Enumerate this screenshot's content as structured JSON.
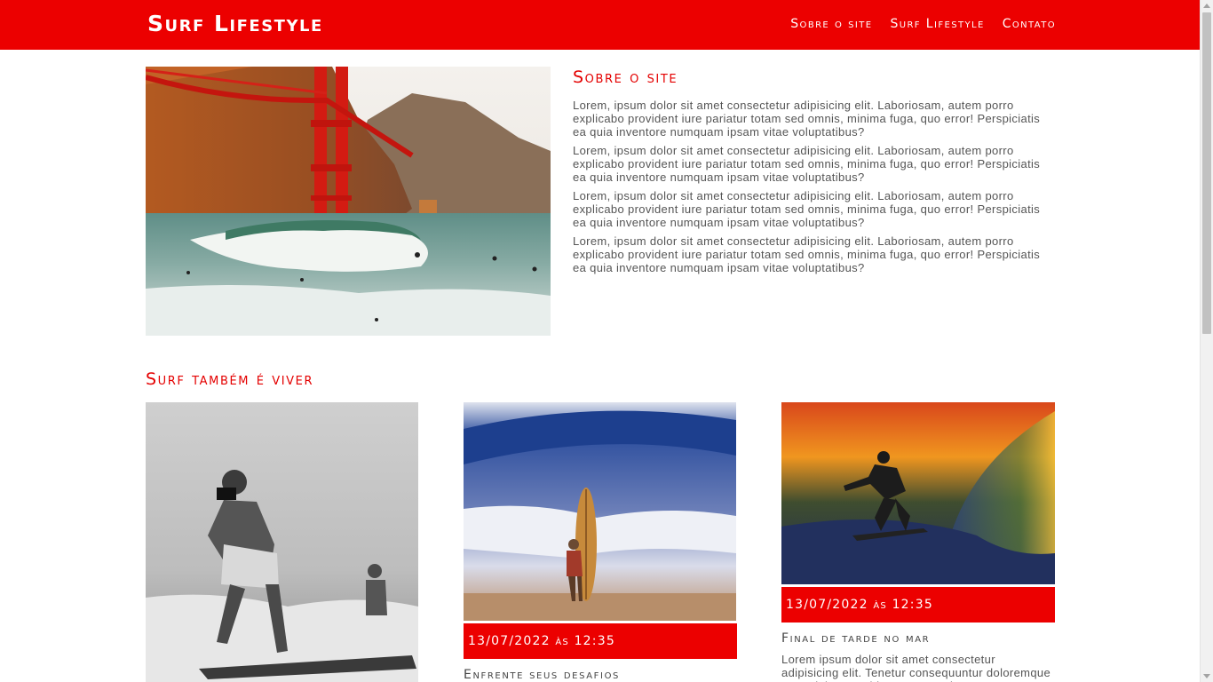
{
  "header": {
    "brand": "Surf Lifestyle",
    "nav": [
      "Sobre o site",
      "Surf Lifestyle",
      "Contato"
    ]
  },
  "about": {
    "title": "Sobre o site",
    "paragraphs": [
      "Lorem, ipsum dolor sit amet consectetur adipisicing elit. Laboriosam, autem porro explicabo provident iure pariatur totam sed omnis, minima fuga, quo error! Perspiciatis ea quia inventore numquam ipsam vitae voluptatibus?",
      "Lorem, ipsum dolor sit amet consectetur adipisicing elit. Laboriosam, autem porro explicabo provident iure pariatur totam sed omnis, minima fuga, quo error! Perspiciatis ea quia inventore numquam ipsam vitae voluptatibus?",
      "Lorem, ipsum dolor sit amet consectetur adipisicing elit. Laboriosam, autem porro explicabo provident iure pariatur totam sed omnis, minima fuga, quo error! Perspiciatis ea quia inventore numquam ipsam vitae voluptatibus?",
      "Lorem, ipsum dolor sit amet consectetur adipisicing elit. Laboriosam, autem porro explicabo provident iure pariatur totam sed omnis, minima fuga, quo error! Perspiciatis ea quia inventore numquam ipsam vitae voluptatibus?"
    ]
  },
  "section": {
    "title": "Surf também é viver"
  },
  "cards": [
    {
      "date": "",
      "title": "",
      "text": ""
    },
    {
      "date": "13/07/2022 às 12:35",
      "title": "Enfrente seus desafios",
      "text": ""
    },
    {
      "date": "13/07/2022 às 12:35",
      "title": "Final de tarde no mar",
      "text": "Lorem ipsum dolor sit amet consectetur adipisicing elit. Tenetur consequuntur doloremque totam labore architecto. Corporis"
    }
  ],
  "colors": {
    "brand": "#ec0000",
    "heading": "#e40000",
    "text": "#555555"
  }
}
